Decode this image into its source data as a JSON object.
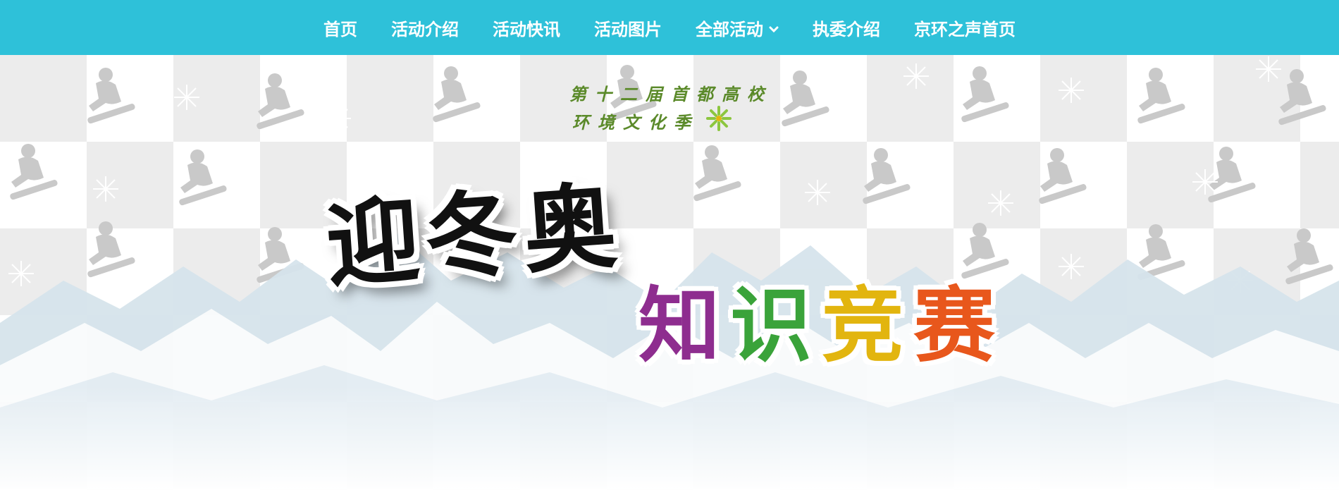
{
  "nav": {
    "items": [
      {
        "label": "首页"
      },
      {
        "label": "活动介绍"
      },
      {
        "label": "活动快讯"
      },
      {
        "label": "活动图片"
      },
      {
        "label": "全部活动",
        "has_dropdown": true
      },
      {
        "label": "执委介绍"
      },
      {
        "label": "京环之声首页"
      }
    ],
    "background_color": "#2ec1d9",
    "text_color": "#ffffff"
  },
  "banner": {
    "event_line_1": "第十二届首都高校",
    "event_line_2": "环境文化季",
    "title_main": "迎冬奥",
    "title_sub_chars": [
      {
        "char": "知",
        "color": "#8e2d8f"
      },
      {
        "char": "识",
        "color": "#3aa33a"
      },
      {
        "char": "竞",
        "color": "#e2b50f"
      },
      {
        "char": "赛",
        "color": "#e8571c"
      }
    ],
    "mountain_color": "#d6e4ec",
    "checker_color": "#ececec",
    "icons": [
      "snowboarder-silhouette-icon",
      "snowflake-icon",
      "flower-logo-icon"
    ]
  }
}
